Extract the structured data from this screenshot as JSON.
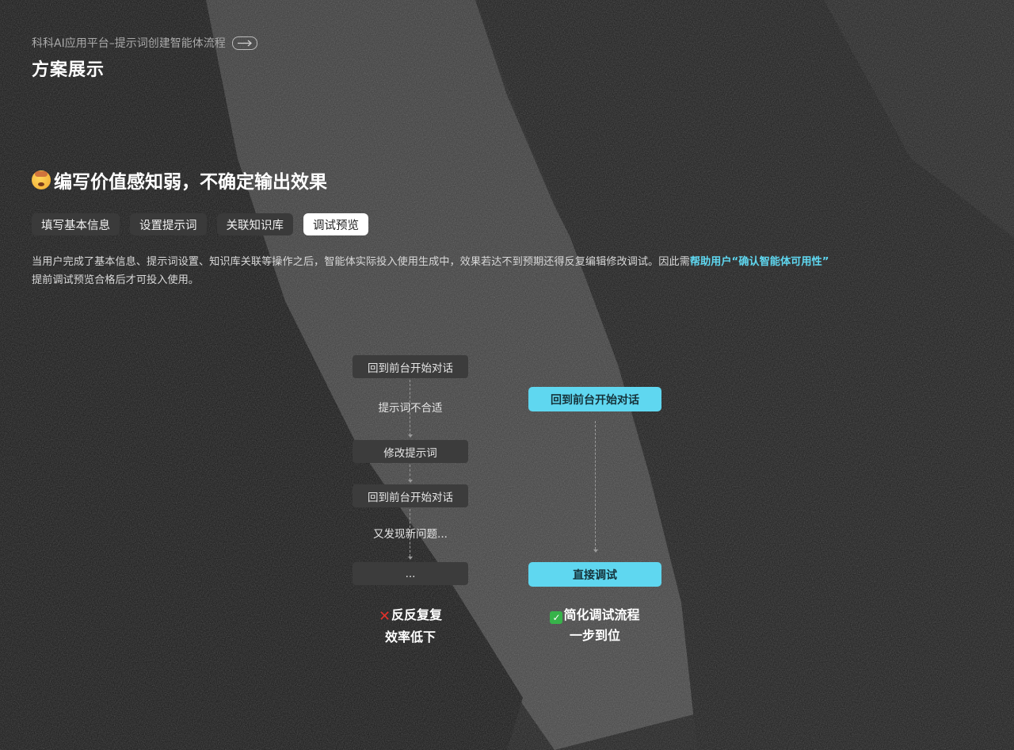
{
  "header": {
    "breadcrumb": "科科AI应用平台–提示词创建智能体流程",
    "page_title": "方案展示"
  },
  "section": {
    "heading": "编写价值感知弱，不确定输出效果"
  },
  "tabs": [
    {
      "label": "填写基本信息",
      "active": false
    },
    {
      "label": "设置提示词",
      "active": false
    },
    {
      "label": "关联知识库",
      "active": false
    },
    {
      "label": "调试预览",
      "active": true
    }
  ],
  "description": {
    "text_before": "当用户完成了基本信息、提示词设置、知识库关联等操作之后，智能体实际投入使用生成中，效果若达不到预期还得反复编辑修改调试。因此需",
    "highlight": "帮助用户“确认智能体可用性”",
    "text_after": "提前调试预览合格后才可投入使用。"
  },
  "flow_before": {
    "steps": [
      "回到前台开始对话",
      "提示词不合适",
      "修改提示词",
      "回到前台开始对话",
      "又发现新问题...",
      "..."
    ],
    "verdict_line1": "反反复复",
    "verdict_line2": "效率低下"
  },
  "flow_after": {
    "steps": [
      "回到前台开始对话",
      "直接调试"
    ],
    "verdict_line1": "简化调试流程",
    "verdict_line2": "一步到位"
  },
  "colors": {
    "accent": "#5fd7f0",
    "dark_node": "#3c3c3c",
    "check_green": "#37b34a",
    "cross_red": "#e0312b"
  },
  "icons": {
    "breadcrumb_arrow": "arrow-right-icon",
    "heading_emoji": "exploding-head-emoji-icon",
    "cross": "cross-mark-icon",
    "check": "check-mark-icon"
  }
}
